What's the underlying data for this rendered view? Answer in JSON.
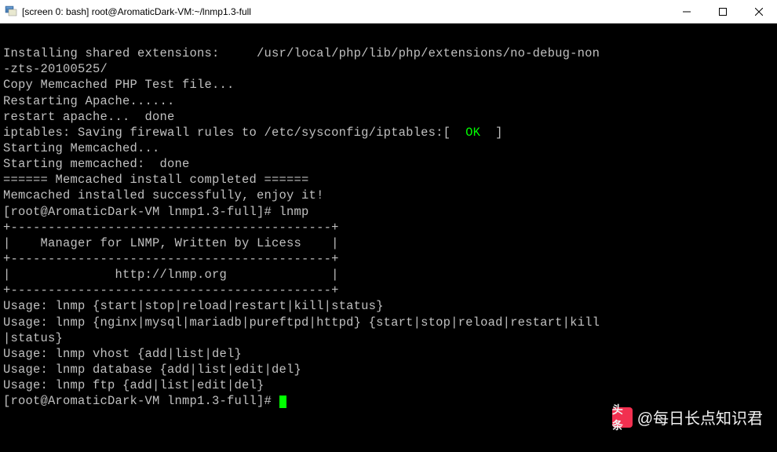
{
  "titlebar": {
    "text": "[screen 0: bash] root@AromaticDark-VM:~/lnmp1.3-full"
  },
  "terminal": {
    "lines": [
      {
        "t": ""
      },
      {
        "t": "Installing shared extensions:     /usr/local/php/lib/php/extensions/no-debug-non"
      },
      {
        "t": "-zts-20100525/"
      },
      {
        "t": "Copy Memcached PHP Test file..."
      },
      {
        "t": "Restarting Apache......"
      },
      {
        "t": "restart apache...  done"
      },
      {
        "type": "iptables",
        "pre": "iptables: Saving firewall rules to /etc/sysconfig/iptables:[  ",
        "ok": "OK",
        "post": "  ]"
      },
      {
        "t": "Starting Memcached..."
      },
      {
        "t": "Starting memcached:  done"
      },
      {
        "t": "====== Memcached install completed ======"
      },
      {
        "t": "Memcached installed successfully, enjoy it!"
      },
      {
        "t": "[root@AromaticDark-VM lnmp1.3-full]# lnmp"
      },
      {
        "t": "+-------------------------------------------+"
      },
      {
        "t": "|    Manager for LNMP, Written by Licess    |"
      },
      {
        "t": "+-------------------------------------------+"
      },
      {
        "t": "|              http://lnmp.org              |"
      },
      {
        "t": "+-------------------------------------------+"
      },
      {
        "t": "Usage: lnmp {start|stop|reload|restart|kill|status}"
      },
      {
        "t": "Usage: lnmp {nginx|mysql|mariadb|pureftpd|httpd} {start|stop|reload|restart|kill"
      },
      {
        "t": "|status}"
      },
      {
        "t": "Usage: lnmp vhost {add|list|del}"
      },
      {
        "t": "Usage: lnmp database {add|list|edit|del}"
      },
      {
        "t": "Usage: lnmp ftp {add|list|edit|del}"
      },
      {
        "type": "prompt",
        "t": "[root@AromaticDark-VM lnmp1.3-full]# "
      }
    ]
  },
  "watermark": {
    "logo_text": "头条",
    "text": "@每日长点知识君"
  }
}
